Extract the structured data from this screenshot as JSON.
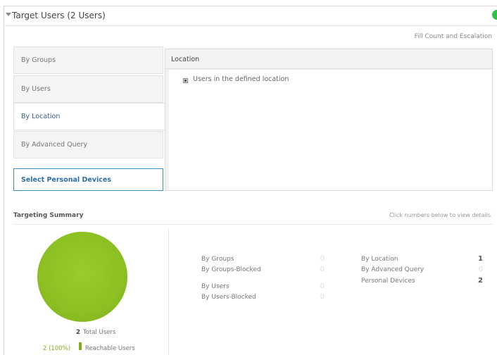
{
  "header": {
    "title": "Target Users (2 Users)",
    "fill_link": "Fill Count and Escalation"
  },
  "tabs": [
    {
      "label": "By Groups"
    },
    {
      "label": "By Users"
    },
    {
      "label": "By Location"
    },
    {
      "label": "By Advanced Query"
    }
  ],
  "personal_tab": {
    "label": "Select Personal Devices"
  },
  "location": {
    "title": "Location",
    "checkbox_label": "Users in the defined location"
  },
  "summary": {
    "title": "Targeting Summary",
    "hint": "Click numbers below to view details",
    "total_count": "2",
    "total_label": "Total Users",
    "reachable_count": "2 (100%)",
    "reachable_label": "Reachable Users"
  },
  "stats": {
    "groups": {
      "label": "By Groups",
      "value": "0"
    },
    "groups_blocked": {
      "label": "By Groups-Blocked",
      "value": "0"
    },
    "users": {
      "label": "By Users",
      "value": "0"
    },
    "users_blocked": {
      "label": "By Users-Blocked",
      "value": "0"
    },
    "location": {
      "label": "By Location",
      "value": "1"
    },
    "advanced_query": {
      "label": "By Advanced Query",
      "value": "0"
    },
    "personal_devices": {
      "label": "Personal Devices",
      "value": "2"
    }
  },
  "colors": {
    "accent_green": "#8cc023",
    "status_green": "#2ec24a",
    "link_blue": "#2a6fa8"
  }
}
